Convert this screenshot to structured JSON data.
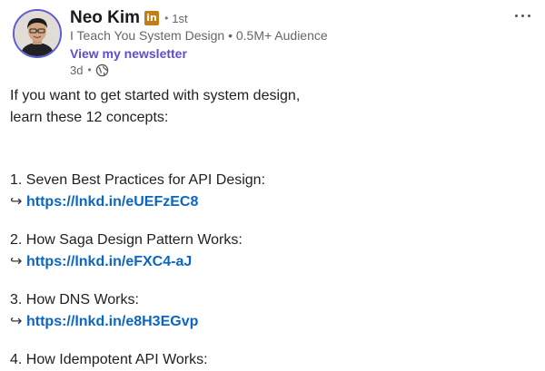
{
  "author": {
    "name": "Neo Kim",
    "badge_text": "in",
    "degree": "1st",
    "headline": "I Teach You System Design • 0.5M+ Audience",
    "newsletter_link": "View my newsletter",
    "time_ago": "3d",
    "visibility_icon": "globe-icon"
  },
  "menu": {
    "icon": "more-horizontal-icon"
  },
  "post": {
    "intro_line1": "If you want to get started with system design,",
    "intro_line2": "learn these 12 concepts:",
    "items": [
      {
        "title": "1. Seven Best Practices for API Design:",
        "arrow": "↪",
        "link": "https://lnkd.in/eUEFzEC8"
      },
      {
        "title": "2. How Saga Design Pattern Works:",
        "arrow": "↪",
        "link": "https://lnkd.in/eFXC4-aJ"
      },
      {
        "title": "3. How DNS Works:",
        "arrow": "↪",
        "link": "https://lnkd.in/e8H3EGvp"
      },
      {
        "title": "4. How Idempotent API Works:"
      }
    ]
  },
  "colors": {
    "accent_purple": "#5d4fc9",
    "link_blue": "#0a66c2",
    "badge_gold": "#c37d16",
    "avatar_ring": "#5b5bd6"
  }
}
